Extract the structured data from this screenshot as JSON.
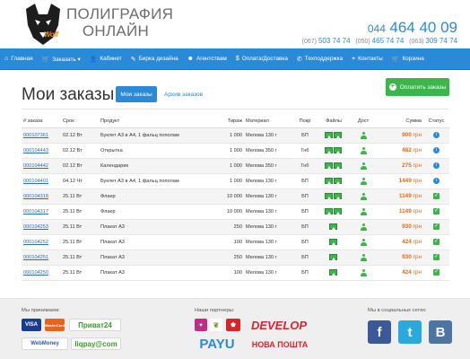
{
  "header": {
    "brand_line1": "ПОЛИГРАФИЯ",
    "brand_line2": "ОНЛАЙН",
    "logo_text": "Woff",
    "phone_prefix": "044",
    "phone_number": "464 40 09",
    "small_phones": [
      {
        "code": "(067)",
        "number": "503 74 74"
      },
      {
        "code": "(050)",
        "number": "465 74 74"
      },
      {
        "code": "(063)",
        "number": "309 74 74"
      }
    ]
  },
  "nav": {
    "items": [
      {
        "label": "Главная",
        "icon": "home-icon",
        "glyph": "⌂"
      },
      {
        "label": "Заказать ▾",
        "icon": "cart-icon",
        "glyph": "🛒"
      },
      {
        "label": "Кабинет",
        "icon": "user-icon",
        "glyph": "👤"
      },
      {
        "label": "Бирка дизайна",
        "icon": "pencil-icon",
        "glyph": "✎"
      },
      {
        "label": "Агентствам",
        "icon": "users-icon",
        "glyph": "☻"
      },
      {
        "label": "Оплата/Доставка",
        "icon": "dollar-icon",
        "glyph": "$"
      },
      {
        "label": "Техподдержка",
        "icon": "wrench-icon",
        "glyph": "✆"
      },
      {
        "label": "Контакты",
        "icon": "map-pin-icon",
        "glyph": "⌖"
      },
      {
        "label": "Корзина",
        "icon": "cart-icon",
        "glyph": "🛒"
      }
    ]
  },
  "page": {
    "title": "Мои заказы",
    "tab_active": "Мои заказы",
    "tab_archive": "Архив заказов",
    "pay_button": "Оплатить заказы"
  },
  "table": {
    "headers": [
      "# заказа",
      "Срок",
      "Продукт",
      "Тираж",
      "Материал",
      "Покр",
      "Файлы",
      "Дост",
      "Сумма",
      "Статус"
    ],
    "currency": "грн",
    "rows": [
      {
        "id": "000107361",
        "date": "02.12 Вт",
        "product": "Буклет А3 в А4, 1 фальц пополам",
        "qty": "1 000",
        "material": "Мелова 130 г",
        "coat": "БП",
        "files": 2,
        "sum": "900",
        "status": "info"
      },
      {
        "id": "000104443",
        "date": "02.12 Вт",
        "product": "Открытка",
        "qty": "1 000",
        "material": "Мелова 350 г",
        "coat": "Гнб",
        "files": 2,
        "sum": "482",
        "status": "info"
      },
      {
        "id": "000104442",
        "date": "02.12 Вт",
        "product": "Календарик",
        "qty": "1 000",
        "material": "Мелова 350 г",
        "coat": "Гнб",
        "files": 2,
        "sum": "275",
        "status": "info"
      },
      {
        "id": "000104401",
        "date": "04.12 Чт",
        "product": "Буклет А3 в А4, 1 фальц пополам",
        "qty": "1 000",
        "material": "Мелова 130 г",
        "coat": "БП",
        "files": 2,
        "sum": "1449",
        "status": "info"
      },
      {
        "id": "000104318",
        "date": "25.11 Вт",
        "product": "Флаер",
        "qty": "10 000",
        "material": "Мелова 130 г",
        "coat": "БП",
        "files": 2,
        "sum": "1149",
        "status": "done"
      },
      {
        "id": "000104317",
        "date": "25.11 Вт",
        "product": "Флаер",
        "qty": "10 000",
        "material": "Мелова 130 г",
        "coat": "БП",
        "files": 2,
        "sum": "1149",
        "status": "done"
      },
      {
        "id": "000104253",
        "date": "25.11 Вт",
        "product": "Плакат А3",
        "qty": "250",
        "material": "Мелова 130 г",
        "coat": "БП",
        "files": 1,
        "sum": "930",
        "status": "done"
      },
      {
        "id": "000104252",
        "date": "25.11 Вт",
        "product": "Плакат А3",
        "qty": "100",
        "material": "Мелова 130 г",
        "coat": "БП",
        "files": 1,
        "sum": "424",
        "status": "done"
      },
      {
        "id": "000104251",
        "date": "25.11 Вт",
        "product": "Плакат А3",
        "qty": "250",
        "material": "Мелова 130 г",
        "coat": "БП",
        "files": 1,
        "sum": "930",
        "status": "done"
      },
      {
        "id": "000104250",
        "date": "25.11 Вт",
        "product": "Плакат А3",
        "qty": "100",
        "material": "Мелова 130 г",
        "coat": "БП",
        "files": 1,
        "sum": "424",
        "status": "done"
      }
    ]
  },
  "footer": {
    "accept_title": "Мы принимаем:",
    "partners_title": "Наши партнеры:",
    "social_title": "Мы в социальных сетях:",
    "pay_logos": [
      "VISA",
      "MasterCard",
      "Приват24",
      "WebMoney",
      "liqpay@com"
    ],
    "partner_logos": [
      "DEVELOP",
      "PAYU",
      "НОВА ПОШТА"
    ],
    "social": [
      {
        "glyph": "f",
        "icon": "facebook-icon",
        "color": "#3b5998"
      },
      {
        "glyph": "t",
        "icon": "twitter-icon",
        "color": "#2aa9e0"
      },
      {
        "glyph": "B",
        "icon": "vk-icon",
        "color": "#4c75a3"
      }
    ]
  },
  "colors": {
    "accent": "#2b8ad8",
    "price": "#e86a10",
    "success": "#3cb54a"
  }
}
